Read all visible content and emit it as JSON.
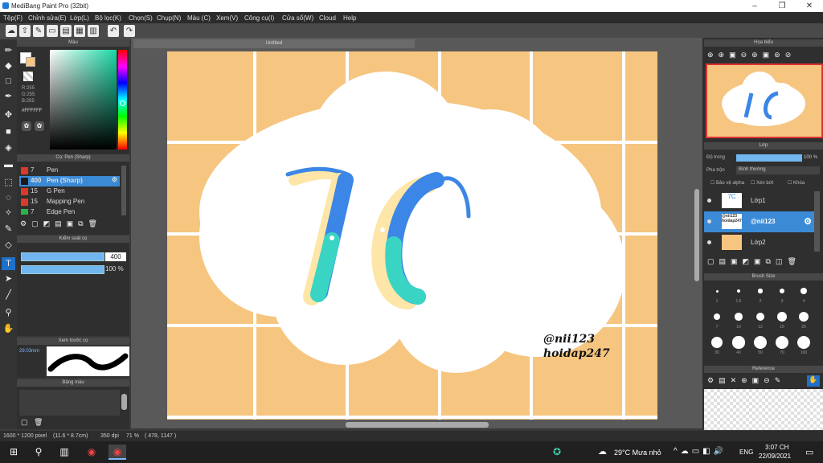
{
  "window": {
    "title": "MediBang Paint Pro (32bit)"
  },
  "menu": [
    "Tệp(F)",
    "Chỉnh sửa(E)",
    "Lớp(L)",
    "Bộ lọc(K)",
    "Chọn(S)",
    "Chụp(N)",
    "Màu (C)",
    "Xem(V)",
    "Công cụ(I)",
    "Cửa sổ(W)",
    "Cloud",
    "Help"
  ],
  "color_panel": {
    "title": "Màu",
    "r": "R:255",
    "g": "G:255",
    "b": "B:255",
    "hex": "#FFFFFF",
    "primary": "#ffffff",
    "secondary": "#f6c580"
  },
  "brush_panel": {
    "title": "Cọ: Pen (Sharp)",
    "items": [
      {
        "size": "7",
        "name": "Pen",
        "color": "#d93a2b"
      },
      {
        "size": "400",
        "name": "Pen (Sharp)",
        "color": "#1a1a1a"
      },
      {
        "size": "15",
        "name": "G Pen",
        "color": "#d93a2b"
      },
      {
        "size": "15",
        "name": "Mapping Pen",
        "color": "#d93a2b"
      },
      {
        "size": "7",
        "name": "Edge Pen",
        "color": "#2bb34a"
      }
    ]
  },
  "brush_control": {
    "title": "Kiểm soát cọ",
    "size": "400",
    "opacity": "100 %",
    "size_level": 1.0,
    "opacity_level": 1.0
  },
  "brush_preview": {
    "title": "Xem trước cọ",
    "size_label": "29.03mm"
  },
  "palette": {
    "title": "Bảng màu"
  },
  "document": {
    "tab": "Untitled",
    "text1": "@nii123",
    "text2": "hoidap247",
    "logo": "7C"
  },
  "navigator": {
    "title": "Họa biểu"
  },
  "layer_panel": {
    "title": "Lớp",
    "opacity_label": "Độ trong",
    "opacity_value": "100 %",
    "blend_label": "Pha trộn",
    "blend_value": "Bình thường",
    "protect_alpha": "Bảo vệ alpha",
    "clipping": "Xén bớt",
    "lock": "Khóa",
    "layers": [
      {
        "name": "Lớp1",
        "thumb": "7C"
      },
      {
        "name": "@nii123",
        "thumb": "@nii123 hoidap247"
      },
      {
        "name": "Lớp2",
        "thumb": ""
      }
    ]
  },
  "brush_size": {
    "title": "Brush Size",
    "labels": [
      "1",
      "1.5",
      "2",
      "3",
      "4",
      "7",
      "10",
      "12",
      "15",
      "20",
      "30",
      "40",
      "50",
      "70",
      "100"
    ]
  },
  "reference": {
    "title": "Reference"
  },
  "status": {
    "dims": "1600 * 1200 pixel",
    "size_mm": "(11.6 * 8.7cm)",
    "dpi": "350 dpi",
    "zoom": "71 %",
    "coords": "( 478, 1147 )"
  },
  "taskbar": {
    "weather": "29°C  Mưa nhỏ",
    "lang": "ENG",
    "time": "3:07 CH",
    "date": "22/09/2021"
  }
}
